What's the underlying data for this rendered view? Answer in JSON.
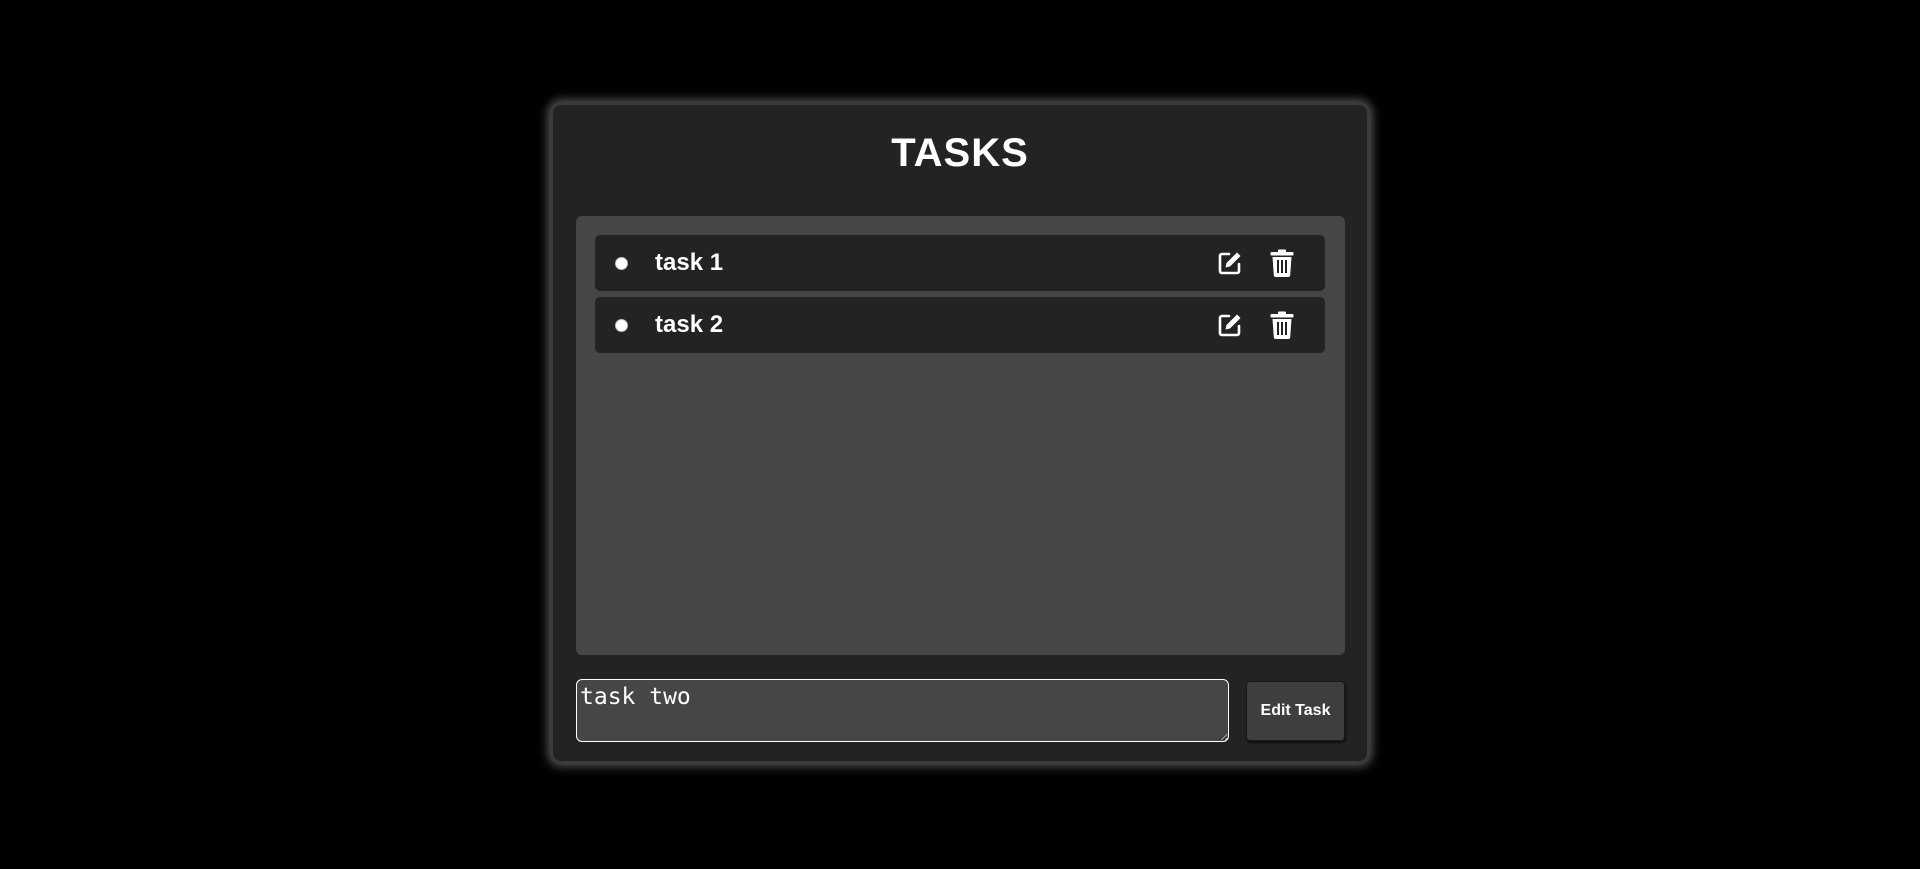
{
  "app": {
    "title": "TASKS"
  },
  "tasks": [
    {
      "text": "task 1",
      "completed": false
    },
    {
      "text": "task 2",
      "completed": false
    }
  ],
  "icons": {
    "edit": "edit-icon",
    "delete": "trash-icon"
  },
  "input": {
    "value": "task two",
    "placeholder": ""
  },
  "action_button": {
    "label": "Edit Task"
  },
  "colors": {
    "page_background": "#000000",
    "card_background": "#232323",
    "list_background": "#464646",
    "row_background": "#232323",
    "text": "#ffffff"
  }
}
